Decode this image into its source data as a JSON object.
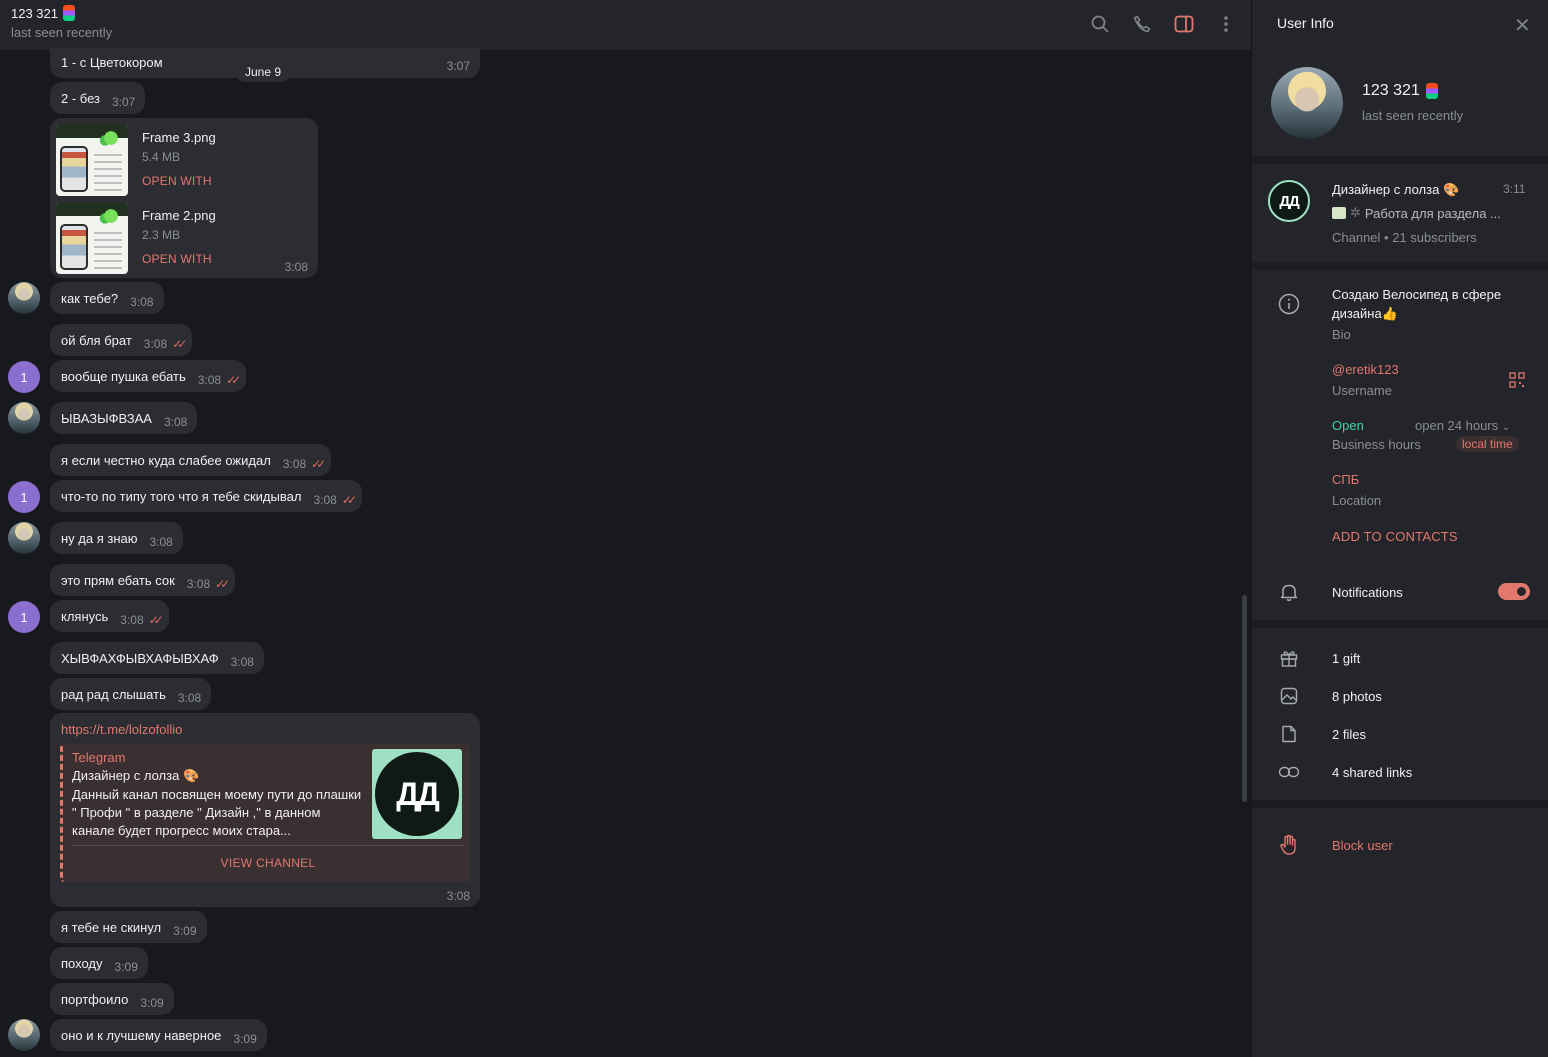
{
  "header": {
    "title": "123 321",
    "status": "last seen recently"
  },
  "date_pill": "June 9",
  "messages": [
    {
      "text": "1 - с Цветокором",
      "time": "3:07"
    },
    {
      "text": "2 - без",
      "time": "3:07"
    },
    {
      "text": "как тебе?",
      "time": "3:08"
    },
    {
      "text": "ой бля брат",
      "time": "3:08"
    },
    {
      "text": "вообще пушка ебать",
      "time": "3:08"
    },
    {
      "text": "ЫВАЗЫФВЗАА",
      "time": "3:08"
    },
    {
      "text": "я если честно куда слабее ожидал",
      "time": "3:08"
    },
    {
      "text": "что-то по типу того что я тебе скидывал",
      "time": "3:08"
    },
    {
      "text": "ну да я знаю",
      "time": "3:08"
    },
    {
      "text": "это прям ебать сок",
      "time": "3:08"
    },
    {
      "text": "клянусь",
      "time": "3:08"
    },
    {
      "text": "ХЫВФАХФЫВХАФЫВХАФ",
      "time": "3:08"
    },
    {
      "text": "рад рад слышать",
      "time": "3:08"
    },
    {
      "text": "я тебе не скинул",
      "time": "3:09"
    },
    {
      "text": "походу",
      "time": "3:09"
    },
    {
      "text": "портфоило",
      "time": "3:09"
    },
    {
      "text": "оно и к лучшему наверное",
      "time": "3:09"
    }
  ],
  "avatar_one_label": "1",
  "files": {
    "time": "3:08",
    "items": [
      {
        "name": "Frame 3.png",
        "size": "5.4 MB",
        "action": "OPEN WITH"
      },
      {
        "name": "Frame 2.png",
        "size": "2.3 MB",
        "action": "OPEN WITH"
      }
    ]
  },
  "link_message": {
    "url": "https://t.me/lolzofollio",
    "site": "Telegram",
    "title": "Дизайнер с лолза 🎨",
    "description": "Данный канал посвящен моему пути до плашки \" Профи \" в разделе \" Дизайн ,\" в данном канале будет прогресс моих стара...",
    "logo_text": "ДД",
    "button": "VIEW CHANNEL",
    "time": "3:08"
  },
  "user_info": {
    "title": "User Info",
    "close": "✕",
    "name": "123 321",
    "status": "last seen recently",
    "channel": {
      "logo_text": "ДД",
      "name": "Дизайнер с лолза 🎨",
      "time": "3:11",
      "last_message": "Работа для раздела ...",
      "subtitle": "Channel • 21 subscribers"
    },
    "bio": {
      "text_line1": "Создаю Велосипед в сфере",
      "text_line2": "дизайна👍",
      "label": "Bio"
    },
    "username": {
      "value": "@eretik123",
      "label": "Username"
    },
    "business_hours": {
      "status": "Open",
      "hours": "open 24 hours",
      "label": "Business hours",
      "pill": "local time"
    },
    "location": {
      "value": "СПБ",
      "label": "Location"
    },
    "add_contact": "ADD TO CONTACTS",
    "notifications": {
      "label": "Notifications",
      "enabled": true
    },
    "media": [
      {
        "label": "1 gift",
        "icon": "gift-icon"
      },
      {
        "label": "8 photos",
        "icon": "photo-icon"
      },
      {
        "label": "2 files",
        "icon": "file-icon"
      },
      {
        "label": "4 shared links",
        "icon": "link-icon"
      }
    ],
    "block": "Block user"
  },
  "colors": {
    "accent": "#e2786d",
    "bubble": "#2b2d32",
    "panel": "#23252a",
    "background": "#17191c",
    "online": "#3fd1a6"
  }
}
